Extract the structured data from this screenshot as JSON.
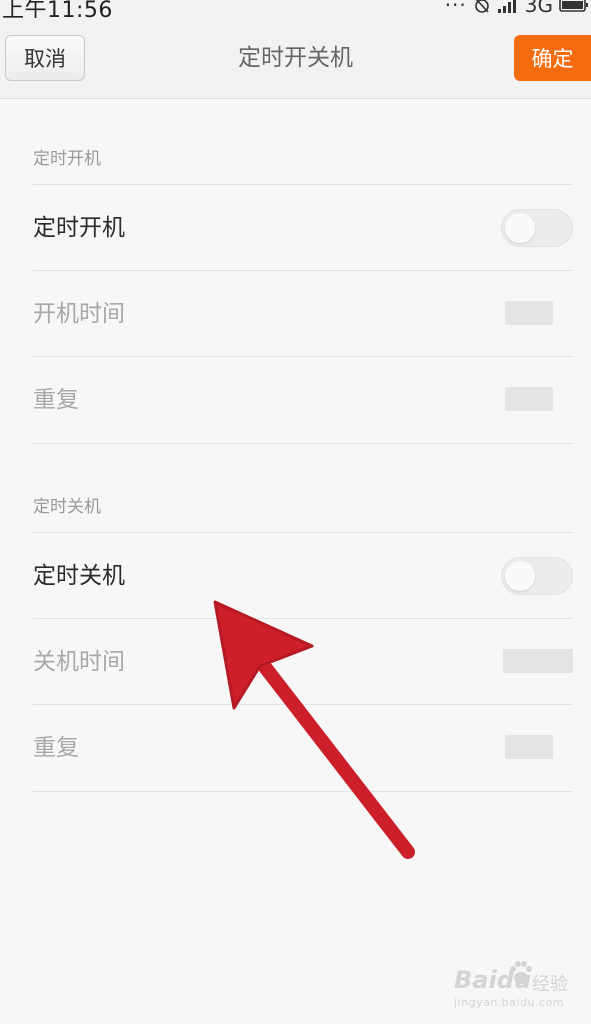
{
  "status_bar": {
    "time": "上午11:56",
    "network": "3G",
    "icons": [
      "more-dots-icon",
      "alarm-off-icon",
      "signal-icon",
      "battery-icon"
    ]
  },
  "action_bar": {
    "cancel_label": "取消",
    "title": "定时开关机",
    "confirm_label": "确定",
    "confirm_color": "#f46c0f"
  },
  "power_on": {
    "section_title": "定时开机",
    "toggle_label": "定时开机",
    "time_label": "开机时间",
    "repeat_label": "重复"
  },
  "power_off": {
    "section_title": "定时关机",
    "toggle_label": "定时关机",
    "time_label": "关机时间",
    "repeat_label": "重复"
  },
  "annotation": {
    "arrow_color": "#cc1f2a",
    "points_to": "定时关机"
  },
  "watermark": {
    "brand": "Baidu",
    "product": "经验",
    "domain": "jingyan.baidu.com"
  }
}
